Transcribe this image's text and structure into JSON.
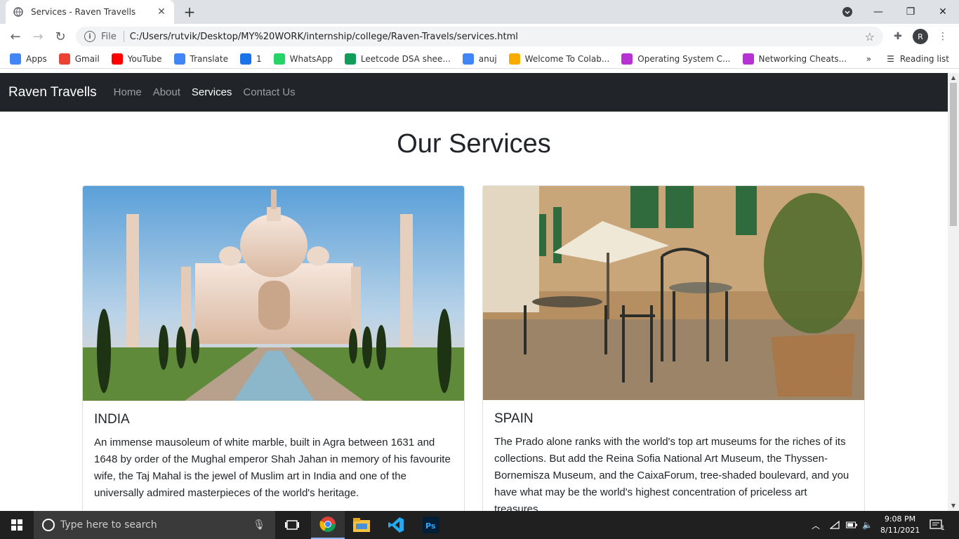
{
  "browser": {
    "tab_title": "Services - Raven Travells",
    "url_scheme": "File",
    "url": "C:/Users/rutvik/Desktop/MY%20WORK/internship/college/Raven-Travels/services.html",
    "profile_initial": "R"
  },
  "bookmarks": [
    {
      "label": "Apps",
      "icon": "apps-grid-icon",
      "color": "#4285f4"
    },
    {
      "label": "Gmail",
      "icon": "gmail-icon",
      "color": "#ea4335"
    },
    {
      "label": "YouTube",
      "icon": "youtube-icon",
      "color": "#ff0000"
    },
    {
      "label": "Translate",
      "icon": "translate-icon",
      "color": "#4285f4"
    },
    {
      "label": "1",
      "icon": "s-icon",
      "color": "#1a73e8"
    },
    {
      "label": "WhatsApp",
      "icon": "whatsapp-icon",
      "color": "#25d366"
    },
    {
      "label": "Leetcode DSA shee...",
      "icon": "sheets-icon",
      "color": "#0f9d58"
    },
    {
      "label": "anuj",
      "icon": "docs-icon",
      "color": "#4285f4"
    },
    {
      "label": "Welcome To Colab...",
      "icon": "colab-icon",
      "color": "#f9ab00"
    },
    {
      "label": "Operating System C...",
      "icon": "m-icon",
      "color": "#b732d3"
    },
    {
      "label": "Networking Cheats...",
      "icon": "m-icon",
      "color": "#b732d3"
    }
  ],
  "bookmarks_overflow": "»",
  "reading_list": "Reading list",
  "site": {
    "brand": "Raven Travells",
    "nav": [
      {
        "label": "Home",
        "active": false
      },
      {
        "label": "About",
        "active": false
      },
      {
        "label": "Services",
        "active": true
      },
      {
        "label": "Contact Us",
        "active": false
      }
    ],
    "heading": "Our Services",
    "cards": [
      {
        "title": "INDIA",
        "image": "taj-mahal-image",
        "text": "An immense mausoleum of white marble, built in Agra between 1631 and 1648 by order of the Mughal emperor Shah Jahan in memory of his favourite wife, the Taj Mahal is the jewel of Muslim art in India and one of the universally admired masterpieces of the world's heritage."
      },
      {
        "title": "SPAIN",
        "image": "spanish-cafe-image",
        "text": "The Prado alone ranks with the world's top art museums for the riches of its collections. But add the Reina Sofia National Art Museum, the Thyssen-Bornemisza Museum, and the CaixaForum, tree-shaded boulevard, and you have what may be the world's highest concentration of priceless art treasures."
      }
    ]
  },
  "taskbar": {
    "search_placeholder": "Type here to search",
    "time": "9:08 PM",
    "date": "8/11/2021",
    "notifications": "1"
  },
  "colors": {
    "navbar_bg": "#212529",
    "taskbar_bg": "#202020",
    "chrome_tabstrip": "#dee1e6"
  }
}
